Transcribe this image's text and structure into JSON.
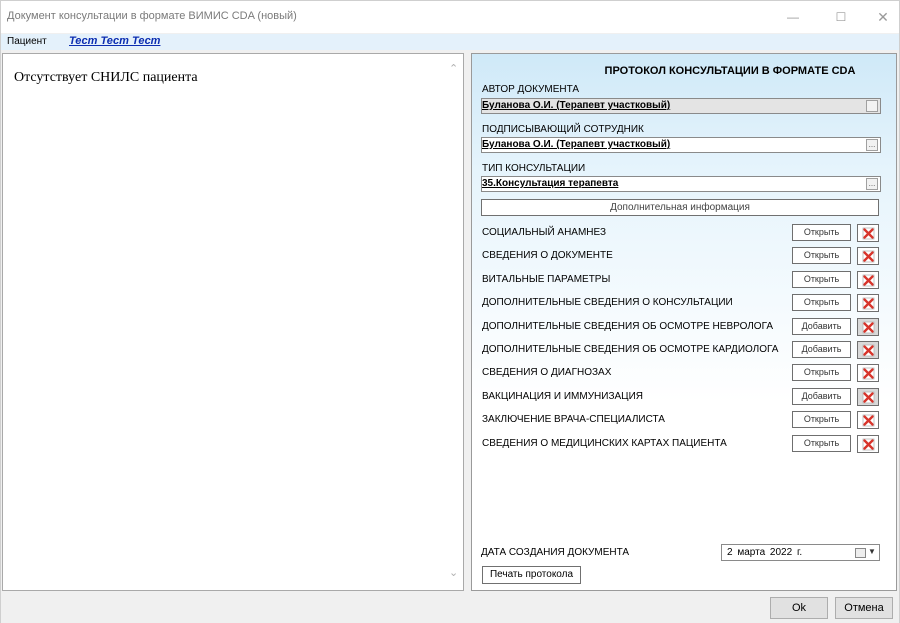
{
  "window": {
    "title": "Документ консультации в формате ВИМИС CDA (новый)",
    "minimize_glyph": "—",
    "maximize_glyph": "☐",
    "close_glyph": "✕"
  },
  "patient": {
    "label": "Пациент",
    "name": "Тест Тест Тест"
  },
  "left_panel": {
    "message": "Отсутствует СНИЛС пациента"
  },
  "protocol": {
    "title": "ПРОТОКОЛ КОНСУЛЬТАЦИИ В ФОРМАТЕ CDA",
    "author": {
      "label": "АВТОР ДОКУМЕНТА",
      "value": "Буланова О.И. (Терапевт участковый)"
    },
    "signer": {
      "label": "ПОДПИСЫВАЮЩИЙ СОТРУДНИК",
      "value": "Буланова О.И. (Терапевт участковый)"
    },
    "consult_type": {
      "label": "ТИП КОНСУЛЬТАЦИИ",
      "value": "35.Консультация терапевта"
    },
    "ellipsis": "...",
    "additional_info_button": "Дополнительная информация",
    "sections": [
      {
        "label": "СОЦИАЛЬНЫЙ АНАМНЕЗ",
        "button": "Открыть"
      },
      {
        "label": "СВЕДЕНИЯ О ДОКУМЕНТЕ",
        "button": "Открыть"
      },
      {
        "label": "ВИТАЛЬНЫЕ ПАРАМЕТРЫ",
        "button": "Открыть"
      },
      {
        "label": "ДОПОЛНИТЕЛЬНЫЕ СВЕДЕНИЯ О КОНСУЛЬТАЦИИ",
        "button": "Открыть"
      },
      {
        "label": "ДОПОЛНИТЕЛЬНЫЕ СВЕДЕНИЯ ОБ ОСМОТРЕ НЕВРОЛОГА",
        "button": "Добавить"
      },
      {
        "label": "ДОПОЛНИТЕЛЬНЫЕ СВЕДЕНИЯ ОБ ОСМОТРЕ КАРДИОЛОГА",
        "button": "Добавить"
      },
      {
        "label": "СВЕДЕНИЯ О ДИАГНОЗАХ",
        "button": "Открыть"
      },
      {
        "label": "ВАКЦИНАЦИЯ И ИММУНИЗАЦИЯ",
        "button": "Добавить"
      },
      {
        "label": "ЗАКЛЮЧЕНИЕ ВРАЧА-СПЕЦИАЛИСТА",
        "button": "Открыть"
      },
      {
        "label": "СВЕДЕНИЯ О МЕДИЦИНСКИХ КАРТАХ ПАЦИЕНТА",
        "button": "Открыть"
      }
    ],
    "creation_date": {
      "label": "ДАТА СОЗДАНИЯ ДОКУМЕНТА",
      "value": "2 марта 2022 г."
    },
    "print_button": "Печать протокола"
  },
  "footer": {
    "ok": "Ok",
    "cancel": "Отмена"
  },
  "icons": {
    "delete": "delete-cross-icon",
    "calendar": "calendar-icon"
  },
  "colors": {
    "patient_name": "#0b2db1",
    "delete_icon": "#d8342b"
  }
}
